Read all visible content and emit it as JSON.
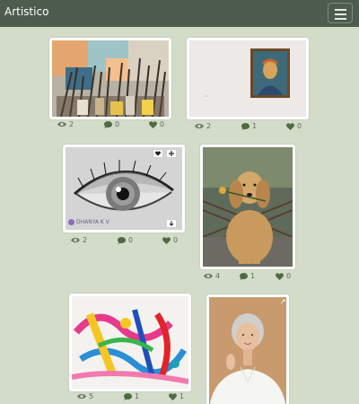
{
  "app": {
    "brand": "Artistico"
  },
  "posts": [
    {
      "title": "Paint brushes",
      "views": "2",
      "comments": "0",
      "likes": "0"
    },
    {
      "title": "Van Gogh self portrait on wall",
      "views": "2",
      "comments": "1",
      "likes": "0"
    },
    {
      "title": "Eye pencil drawing",
      "views": "2",
      "comments": "0",
      "likes": "0",
      "watermark": "DHANYA K V"
    },
    {
      "title": "Golden retriever with flower",
      "views": "4",
      "comments": "1",
      "likes": "0"
    },
    {
      "title": "Colorful abstract painting",
      "views": "5",
      "comments": "1",
      "likes": "1"
    },
    {
      "title": "Woman in white shirt",
      "views": "",
      "comments": "",
      "likes": ""
    }
  ],
  "colors": {
    "navbar": "#4d5c4d",
    "background": "#d3dcc9",
    "stat_text": "#5e6b55"
  },
  "icons": [
    "eye-icon",
    "comment-icon",
    "heart-icon",
    "menu-icon",
    "download-icon",
    "plus-icon",
    "expand-icon"
  ]
}
